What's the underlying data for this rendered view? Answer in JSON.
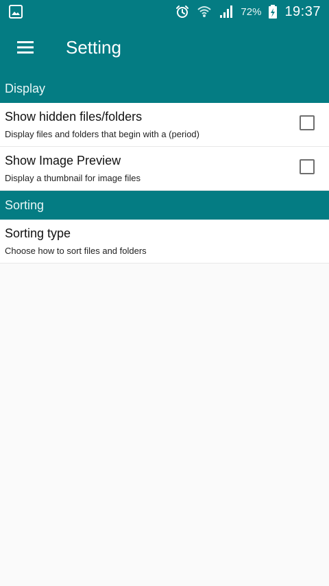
{
  "status_bar": {
    "gallery_icon": "gallery-icon",
    "alarm_icon": "alarm-clock-icon",
    "wifi_icon": "wifi-icon",
    "signal_icon": "cell-signal-icon",
    "battery_percent": "72%",
    "battery_icon": "battery-charging-icon",
    "time": "19:37"
  },
  "toolbar": {
    "menu_icon": "hamburger-menu-icon",
    "title": "Setting"
  },
  "sections": {
    "display": {
      "header": "Display",
      "items": [
        {
          "title": "Show hidden files/folders",
          "summary": "Display files and folders that begin with a (period)",
          "checked": false
        },
        {
          "title": "Show Image Preview",
          "summary": "Display a thumbnail for image files",
          "checked": false
        }
      ]
    },
    "sorting": {
      "header": "Sorting",
      "items": [
        {
          "title": "Sorting type",
          "summary": "Choose how to sort files and folders"
        }
      ]
    }
  },
  "colors": {
    "primary": "#047c83",
    "background": "#fafafa",
    "divider": "#e8e8e8"
  }
}
